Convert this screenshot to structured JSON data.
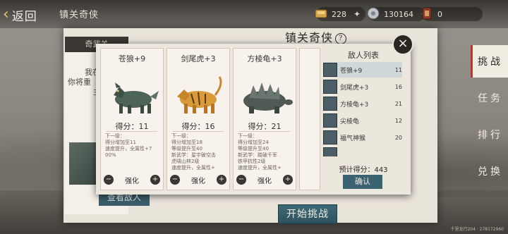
{
  "header": {
    "back_label": "返回",
    "breadcrumb": "镇关奇侠",
    "resources": [
      {
        "icon": "gold-ingot-icon",
        "value": "228"
      },
      {
        "icon": "silver-coin-icon",
        "value": "130164"
      },
      {
        "icon": "token-icon",
        "value": "0"
      }
    ]
  },
  "page": {
    "title": "镇关奇侠",
    "left_card_head": "奇武关",
    "left_card_lines": [
      "我在",
      "你将重",
      "主"
    ],
    "view_enemy_button": "查看敌人",
    "start_button": "开始挑战"
  },
  "side_tabs": [
    "挑战",
    "任务",
    "排行",
    "兑换"
  ],
  "popup": {
    "cards": [
      {
        "name": "苍狼+9",
        "score": "得分：11",
        "desc": [
          "下一级：",
          "得分增加至11",
          "速度提升，全属性+7",
          "00%"
        ],
        "upgrade": "强化"
      },
      {
        "name": "剑尾虎+3",
        "score": "得分：16",
        "desc": [
          "下一级：",
          "得分增加至18",
          "等级提升至40",
          "新武学：星宇破空击",
          "虎啸山林2级",
          "速度提升，全属性+"
        ],
        "upgrade": "强化"
      },
      {
        "name": "方棱龟+3",
        "score": "得分：21",
        "desc": [
          "下一级：",
          "得分增加至24",
          "等级提升至40",
          "新武学：踏破千军",
          "铁甲抗性2级",
          "速度提升，全属性+"
        ],
        "upgrade": "强化"
      }
    ],
    "enemy_list": {
      "title": "敌人列表",
      "rows": [
        {
          "name": "苍狼+9",
          "score": "11"
        },
        {
          "name": "剑尾虎+3",
          "score": "16"
        },
        {
          "name": "方棱龟+3",
          "score": "21"
        },
        {
          "name": "尖棱龟",
          "score": "12"
        },
        {
          "name": "福气神猴",
          "score": "20"
        },
        {
          "name": "",
          "score": ""
        }
      ],
      "total": "预计得分：443",
      "confirm": "确认"
    }
  },
  "footer": "千里龙行204 · 278172960"
}
